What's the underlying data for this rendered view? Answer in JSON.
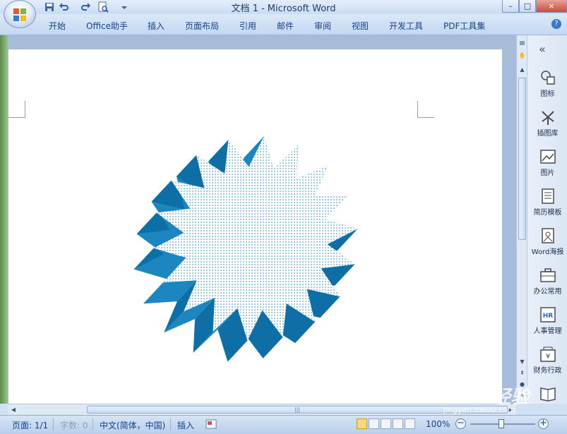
{
  "window": {
    "title": "文档 1 - Microsoft Word"
  },
  "ribbon": {
    "tabs": [
      "开始",
      "Office助手",
      "插入",
      "页面布局",
      "引用",
      "邮件",
      "审阅",
      "视图",
      "开发工具",
      "PDF工具集"
    ]
  },
  "side_panel": {
    "collapse_label": "«",
    "items": [
      "图标",
      "插图库",
      "图片",
      "简历模板",
      "Word海报",
      "办公常用",
      "人事管理",
      "财务行政"
    ]
  },
  "document": {
    "shape": {
      "type": "starburst",
      "points": 18,
      "fill": "#ffffff",
      "pattern": "dotted",
      "pattern_color": "#1b7fb8",
      "side_color": "#1b86c0"
    }
  },
  "statusbar": {
    "page": "页面: 1/1",
    "words": "字数: 0",
    "language": "中文(简体，中国)",
    "mode": "插入",
    "zoom": "100%",
    "zoom_percent": 100
  },
  "watermark": {
    "logo": "Baidu经验",
    "url": "jingyan.baidu.com"
  },
  "colors": {
    "ribbon": "#c4d8f1",
    "accent": "#15428b",
    "shape_blue": "#1b86c0"
  }
}
